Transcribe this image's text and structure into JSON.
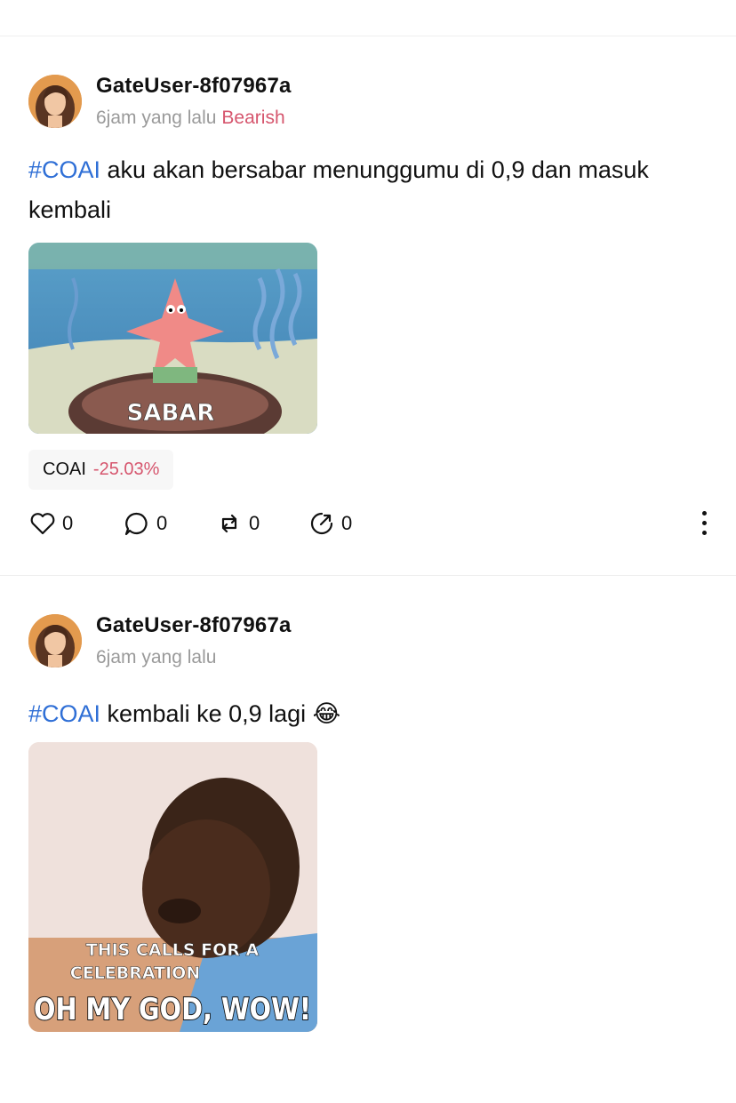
{
  "posts": [
    {
      "username": "GateUser-8f07967a",
      "time": "6jam yang lalu",
      "sentiment": "Bearish",
      "hashtag": "#COAI",
      "text": " aku akan bersabar menunggumu di 0,9 dan masuk kembali",
      "media_caption": "SABAR",
      "ticker": {
        "symbol": "COAI",
        "change": "-25.03%"
      },
      "actions": {
        "likes": "0",
        "comments": "0",
        "reposts": "0",
        "shares": "0"
      }
    },
    {
      "username": "GateUser-8f07967a",
      "time": "6jam yang lalu",
      "hashtag": "#COAI",
      "text": " kembali ke 0,9 lagi 😂",
      "media_caption_small_1": "THIS CALLS FOR A",
      "media_caption_small_2": "CELEBRATION",
      "media_caption_big": "OH MY GOD, WOW!"
    }
  ],
  "colors": {
    "hashtag": "#2f6fd6",
    "bearish": "#d6566e",
    "muted": "#9a9a9a"
  },
  "icons": [
    "heart-icon",
    "comment-icon",
    "repost-icon",
    "share-icon",
    "more-vertical-icon"
  ]
}
